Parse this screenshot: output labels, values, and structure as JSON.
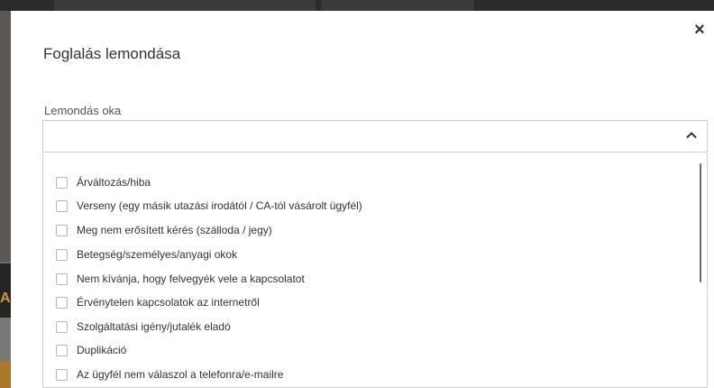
{
  "background": {
    "banner_text": "A ME"
  },
  "modal": {
    "title": "Foglalás lemondása",
    "close_label": "×"
  },
  "cancel_reason": {
    "label": "Lemondás oka",
    "selected_value": "",
    "options": [
      "Árváltozás/hiba",
      "Verseny (egy másik utazási irodától / CA-tól vásárolt ügyfél)",
      "Meg nem erősített kérés (szálloda / jegy)",
      "Betegség/személyes/anyagi okok",
      "Nem kívánja, hogy felvegyék vele a kapcsolatot",
      "Érvénytelen kapcsolatok az internetről",
      "Szolgáltatási igény/jutalék eladó",
      "Duplikáció",
      "Az ügyfél nem válaszol a telefonra/e-mailre"
    ]
  }
}
